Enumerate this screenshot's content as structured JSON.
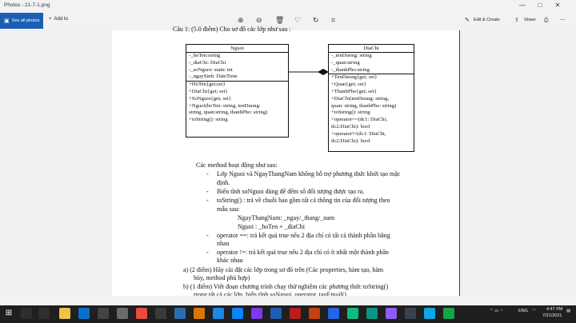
{
  "window": {
    "title": "Photos - 21-7-1.png",
    "controls": [
      "—",
      "□",
      "✕"
    ]
  },
  "toolbar": {
    "see_all": "See all photos",
    "add_to": "Add to",
    "edit_create": "Edit & Create",
    "share": "Share",
    "icons": [
      "zoom-in-icon",
      "zoom-out-icon",
      "delete-icon",
      "favorite-icon",
      "rotate-icon",
      "crop-icon"
    ]
  },
  "document": {
    "question_heading": "Câu 1: (5.0 điểm) Cho sơ đồ các lớp như sau :",
    "classes": [
      {
        "name": "Nguoi",
        "attributes": [
          "-_hoTen:string",
          "-_diaChi: DiaChi",
          "-_soNguoi: static int",
          "-_ngaySinh: DateTime"
        ],
        "methods": [
          "+HoTen{get;set}",
          "+DiaChi{get; set}",
          "+SoNguoi{get; set}",
          "+Nguoi(hoTen: string, tenDuong:",
          "string, quan:string, thanhPho: string)",
          "+toString(): string"
        ]
      },
      {
        "name": "DiaChi",
        "attributes": [
          "-_tenDuong: string",
          "-_quan:string",
          "-_thanhPho:string"
        ],
        "methods": [
          "+TenDuong{get; set}",
          "+Quan{get; set}",
          "+ThanhPho{get; set}",
          "+DiaChi(tenDuong: string,",
          "quan: string, thanhPho: string)",
          "+toString(): string",
          "+operator==(dc1: DiaChi,",
          "dc2:DiaChi): bool",
          "+operator!=(dc1: DiaChi,",
          "dc2:DiaChi): bool"
        ]
      }
    ],
    "text_lines": [
      "Các method hoạt động như sau:",
      "Lớp Nguoi và NgayThangNam không hỗ trợ phương thức khởi tạo mặc",
      "định.",
      "Biến tĩnh soNguoi dùng để đếm số đối tượng được tạo ra.",
      "toString()    : trả về chuỗi bao gồm tất cả thông tin của đối tượng theo",
      "mẫu sau:",
      "NgayThangNam: _ngay/_thang/_nam",
      "Nguoi : _hoTen  +  _diaChi",
      "operator ==: trả kết quả true nếu 2 địa chỉ có tất cả thành phần bằng",
      "nhau",
      "operator !=: trả kết quả true nếu 2 địa chỉ có ít nhất một thành phần",
      "khác nhau",
      "a)   (2 điểm) Hãy cài đặt các lớp trong sơ đồ trên (Các properties, hàm tạo, hàm",
      "hủy, method phù hợp)",
      "b)   (1 điểm) Viết đoạn chương trình chạy thử nghiệm các phương thức toString()",
      "trong tất cả các lớp, biến tĩnh soNguoi, operator, taoEmail()"
    ]
  },
  "taskbar": {
    "lang": "ENG",
    "time": "4:47 PM",
    "date": "7/21/2021"
  }
}
